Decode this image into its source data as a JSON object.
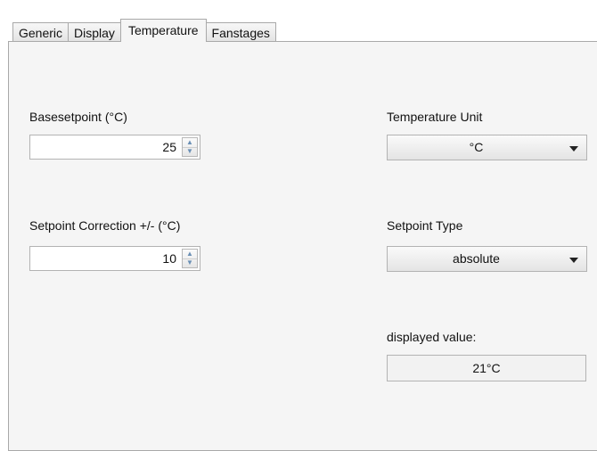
{
  "tabs": [
    {
      "label": "Generic",
      "active": false
    },
    {
      "label": "Display",
      "active": false
    },
    {
      "label": "Temperature",
      "active": true
    },
    {
      "label": "Fanstages",
      "active": false
    }
  ],
  "basesetpoint": {
    "label": "Basesetpoint (°C)",
    "value": "25"
  },
  "setpoint_correction": {
    "label": "Setpoint Correction +/- (°C)",
    "value": "10"
  },
  "temperature_unit": {
    "label": "Temperature Unit",
    "value": "°C"
  },
  "setpoint_type": {
    "label": "Setpoint Type",
    "value": "absolute"
  },
  "displayed_value": {
    "label": "displayed value:",
    "value": "21°C"
  },
  "icons": {
    "spin_up": "triangle-up-icon",
    "spin_down": "triangle-down-icon",
    "dropdown": "chevron-down-icon"
  },
  "colors": {
    "panel_bg": "#f5f5f5",
    "border": "#a9a9a9",
    "spin_arrow": "#6a8fb5"
  }
}
